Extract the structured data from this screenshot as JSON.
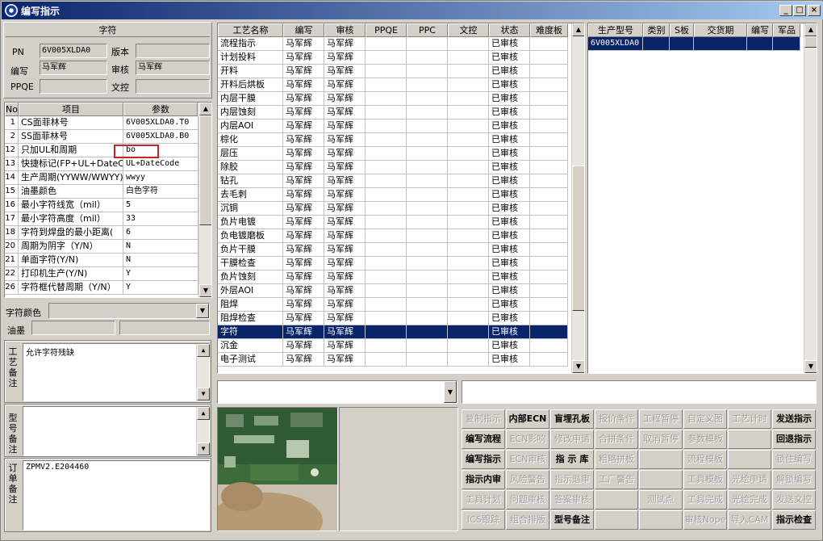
{
  "window": {
    "title": "编写指示",
    "min": "_",
    "max": "□",
    "close": "×"
  },
  "left": {
    "group_title": "字符",
    "pn_label": "PN",
    "pn_value": "6V005XLDA0",
    "version_label": "版本",
    "version_value": "",
    "writer_label": "编写",
    "writer_value": "马军辉",
    "reviewer_label": "审核",
    "reviewer_value": "马军辉",
    "ppqe_label": "PPQE",
    "ppqe_value": "",
    "doc_label": "文控",
    "doc_value": "",
    "table_headers": [
      "No",
      "项目",
      "参数"
    ],
    "table_rows": [
      {
        "no": "1",
        "item": "CS面菲林号",
        "param": "6V005XLDA0.T0"
      },
      {
        "no": "2",
        "item": "SS面菲林号",
        "param": "6V005XLDA0.B0"
      },
      {
        "no": "12",
        "item": "只加UL和周期",
        "param": "bo"
      },
      {
        "no": "13",
        "item": "快捷标记(FP+UL+DateCo",
        "param": "UL+DateCode"
      },
      {
        "no": "14",
        "item": "生产周期(YYWW/WWYY)",
        "param": "wwyy"
      },
      {
        "no": "15",
        "item": "油墨颜色",
        "param": "白色字符"
      },
      {
        "no": "16",
        "item": "最小字符线宽（mil）",
        "param": "5"
      },
      {
        "no": "17",
        "item": "最小字符高度（mil）",
        "param": "33"
      },
      {
        "no": "18",
        "item": "字符到焊盘的最小距离(",
        "param": "6"
      },
      {
        "no": "20",
        "item": "周期为阴字（Y/N）",
        "param": "N"
      },
      {
        "no": "21",
        "item": "单面字符(Y/N)",
        "param": "N"
      },
      {
        "no": "22",
        "item": "打印机生产(Y/N)",
        "param": "Y"
      },
      {
        "no": "26",
        "item": "字符框代替周期（Y/N）",
        "param": "Y"
      }
    ],
    "char_color_label": "字符颜色",
    "char_color_value": "",
    "ink_label": "油墨",
    "process_note_label": "工艺备注",
    "process_note_value": "允许字符残缺",
    "model_note_label": "型号备注",
    "model_note_value": "",
    "order_note_label": "订单备注",
    "order_note_value": "ZPMV2.E204460"
  },
  "process": {
    "headers": [
      "工艺名称",
      "编写",
      "审核",
      "PPQE",
      "PPC",
      "文控",
      "状态",
      "难度板"
    ],
    "rows": [
      [
        "流程指示",
        "马军辉",
        "马军辉",
        "",
        "",
        "",
        "已审核",
        ""
      ],
      [
        "计划投料",
        "马军辉",
        "马军辉",
        "",
        "",
        "",
        "已审核",
        ""
      ],
      [
        "开料",
        "马军辉",
        "马军辉",
        "",
        "",
        "",
        "已审核",
        ""
      ],
      [
        "开料后烘板",
        "马军辉",
        "马军辉",
        "",
        "",
        "",
        "已审核",
        ""
      ],
      [
        "内层干膜",
        "马军辉",
        "马军辉",
        "",
        "",
        "",
        "已审核",
        ""
      ],
      [
        "内层蚀刻",
        "马军辉",
        "马军辉",
        "",
        "",
        "",
        "已审核",
        ""
      ],
      [
        "内层AOI",
        "马军辉",
        "马军辉",
        "",
        "",
        "",
        "已审核",
        ""
      ],
      [
        "棕化",
        "马军辉",
        "马军辉",
        "",
        "",
        "",
        "已审核",
        ""
      ],
      [
        "层压",
        "马军辉",
        "马军辉",
        "",
        "",
        "",
        "已审核",
        ""
      ],
      [
        "除胶",
        "马军辉",
        "马军辉",
        "",
        "",
        "",
        "已审核",
        ""
      ],
      [
        "钻孔",
        "马军辉",
        "马军辉",
        "",
        "",
        "",
        "已审核",
        ""
      ],
      [
        "去毛刺",
        "马军辉",
        "马军辉",
        "",
        "",
        "",
        "已审核",
        ""
      ],
      [
        "沉铜",
        "马军辉",
        "马军辉",
        "",
        "",
        "",
        "已审核",
        ""
      ],
      [
        "负片电镀",
        "马军辉",
        "马军辉",
        "",
        "",
        "",
        "已审核",
        ""
      ],
      [
        "负电镀磨板",
        "马军辉",
        "马军辉",
        "",
        "",
        "",
        "已审核",
        ""
      ],
      [
        "负片干膜",
        "马军辉",
        "马军辉",
        "",
        "",
        "",
        "已审核",
        ""
      ],
      [
        "干膜检查",
        "马军辉",
        "马军辉",
        "",
        "",
        "",
        "已审核",
        ""
      ],
      [
        "负片蚀刻",
        "马军辉",
        "马军辉",
        "",
        "",
        "",
        "已审核",
        ""
      ],
      [
        "外层AOI",
        "马军辉",
        "马军辉",
        "",
        "",
        "",
        "已审核",
        ""
      ],
      [
        "阻焊",
        "马军辉",
        "马军辉",
        "",
        "",
        "",
        "已审核",
        ""
      ],
      [
        "阻焊检查",
        "马军辉",
        "马军辉",
        "",
        "",
        "",
        "已审核",
        ""
      ],
      [
        "字符",
        "马军辉",
        "马军辉",
        "",
        "",
        "",
        "已审核",
        ""
      ],
      [
        "沉金",
        "马军辉",
        "马军辉",
        "",
        "",
        "",
        "已审核",
        ""
      ],
      [
        "电子测试",
        "马军辉",
        "马军辉",
        "",
        "",
        "",
        "已审核",
        ""
      ]
    ],
    "selected_row": "21"
  },
  "model": {
    "headers": [
      "生产型号",
      "类别",
      "S板",
      "交货期",
      "编写",
      "军品"
    ],
    "rows": [
      [
        "6V005XLDA0",
        "",
        "",
        "",
        "",
        ""
      ]
    ]
  },
  "buttons": [
    {
      "label": "复制指示",
      "enabled": false
    },
    {
      "label": "内部ECN",
      "enabled": true
    },
    {
      "label": "盲埋孔板",
      "enabled": true
    },
    {
      "label": "报价条件",
      "enabled": false
    },
    {
      "label": "工程暂停",
      "enabled": false
    },
    {
      "label": "自定义图",
      "enabled": false
    },
    {
      "label": "工艺计时",
      "enabled": false
    },
    {
      "label": "发送指示",
      "enabled": true
    },
    {
      "label": "编写流程",
      "enabled": true
    },
    {
      "label": "ECN影响",
      "enabled": false
    },
    {
      "label": "修改申请",
      "enabled": false
    },
    {
      "label": "合拼条件",
      "enabled": false
    },
    {
      "label": "取消暂停",
      "enabled": false
    },
    {
      "label": "参数模板",
      "enabled": false
    },
    {
      "label": "",
      "enabled": false
    },
    {
      "label": "回退指示",
      "enabled": true
    },
    {
      "label": "编写指示",
      "enabled": true
    },
    {
      "label": "ECN审核",
      "enabled": false
    },
    {
      "label": "指 示 库",
      "enabled": true
    },
    {
      "label": "粗略拼板",
      "enabled": false
    },
    {
      "label": "",
      "enabled": false
    },
    {
      "label": "流程模板",
      "enabled": false
    },
    {
      "label": "",
      "enabled": false
    },
    {
      "label": "锁住编写",
      "enabled": false
    },
    {
      "label": "指示内审",
      "enabled": true
    },
    {
      "label": "风险警告",
      "enabled": false
    },
    {
      "label": "指示退审",
      "enabled": false
    },
    {
      "label": "工厂警告",
      "enabled": false
    },
    {
      "label": "",
      "enabled": false
    },
    {
      "label": "工具模板",
      "enabled": false
    },
    {
      "label": "光绘申请",
      "enabled": false
    },
    {
      "label": "解锁编写",
      "enabled": false
    },
    {
      "label": "工具计划",
      "enabled": false
    },
    {
      "label": "问题审核",
      "enabled": false
    },
    {
      "label": "答案审核",
      "enabled": false
    },
    {
      "label": "",
      "enabled": false
    },
    {
      "label": "测试点",
      "enabled": false
    },
    {
      "label": "工具完成",
      "enabled": false
    },
    {
      "label": "光绘完成",
      "enabled": false
    },
    {
      "label": "发送文控",
      "enabled": false
    },
    {
      "label": "ICS跟踪",
      "enabled": false
    },
    {
      "label": "组合排版",
      "enabled": false
    },
    {
      "label": "型号备注",
      "enabled": true
    },
    {
      "label": "",
      "enabled": false
    },
    {
      "label": "",
      "enabled": false
    },
    {
      "label": "审核Nope",
      "enabled": false
    },
    {
      "label": "导入CAM",
      "enabled": false
    },
    {
      "label": "指示检查",
      "enabled": true
    }
  ],
  "colors": {
    "selection": "#0a246a",
    "highlight_box": "#cc2222",
    "window_bg": "#d4d0c8"
  }
}
